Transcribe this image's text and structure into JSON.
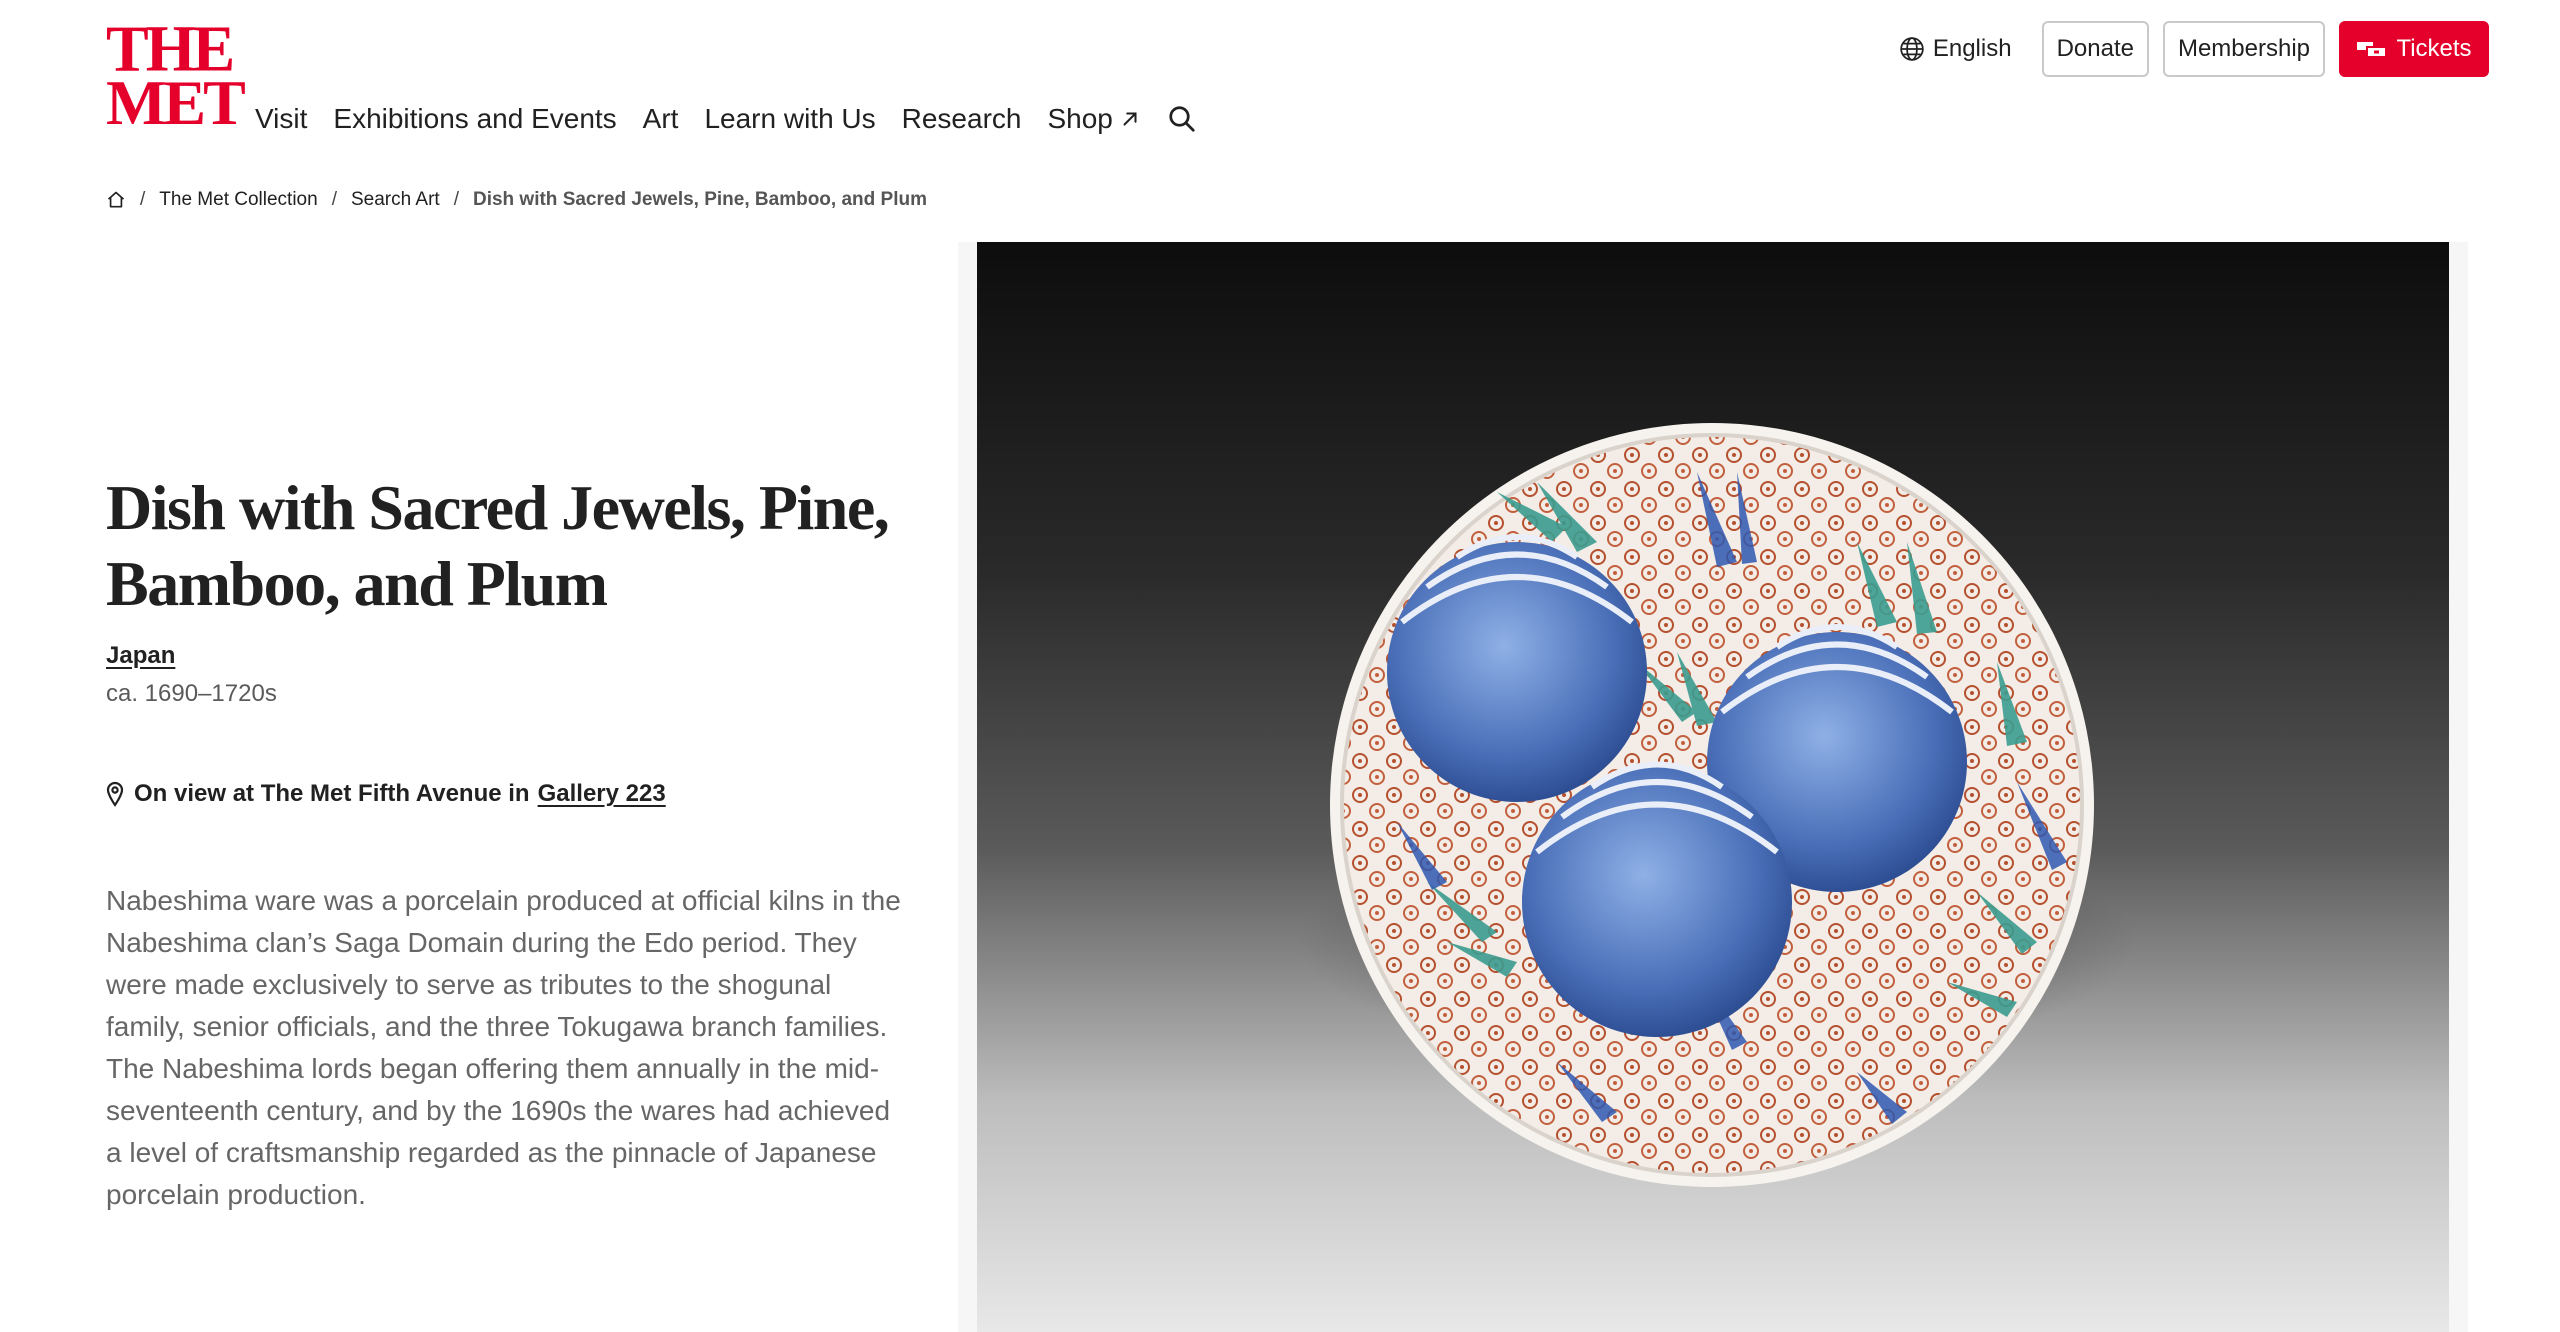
{
  "header": {
    "logo": {
      "line1": "THE",
      "line2": "MET"
    },
    "nav": [
      "Visit",
      "Exhibitions and Events",
      "Art",
      "Learn with Us",
      "Research"
    ],
    "shop_label": "Shop",
    "search_icon": "search-icon",
    "language": "English",
    "donate": "Donate",
    "membership": "Membership",
    "tickets": "Tickets",
    "accent_color": "#e4002b"
  },
  "breadcrumb": {
    "home_icon": "home-icon",
    "items": [
      "The Met Collection",
      "Search Art"
    ],
    "current": "Dish with Sacred Jewels, Pine, Bamboo, and Plum"
  },
  "artwork": {
    "title": "Dish with Sacred Jewels, Pine, Bamboo, and Plum",
    "culture": "Japan",
    "date": "ca. 1690–1720s",
    "on_view_prefix": "On view at The Met Fifth Avenue in",
    "gallery": "Gallery 223",
    "description": "Nabeshima ware was a porcelain produced at official kilns in the Nabeshima clan’s Saga Domain during the Edo period. They were made exclusively to serve as tributes to the shogunal family, senior officials, and the three Tokugawa branch families. The Nabeshima lords began offering them annually in the mid-seventeenth century, and by the 1690s the wares had achieved a level of craftsmanship regarded as the pinnacle of Japanese porcelain production."
  }
}
